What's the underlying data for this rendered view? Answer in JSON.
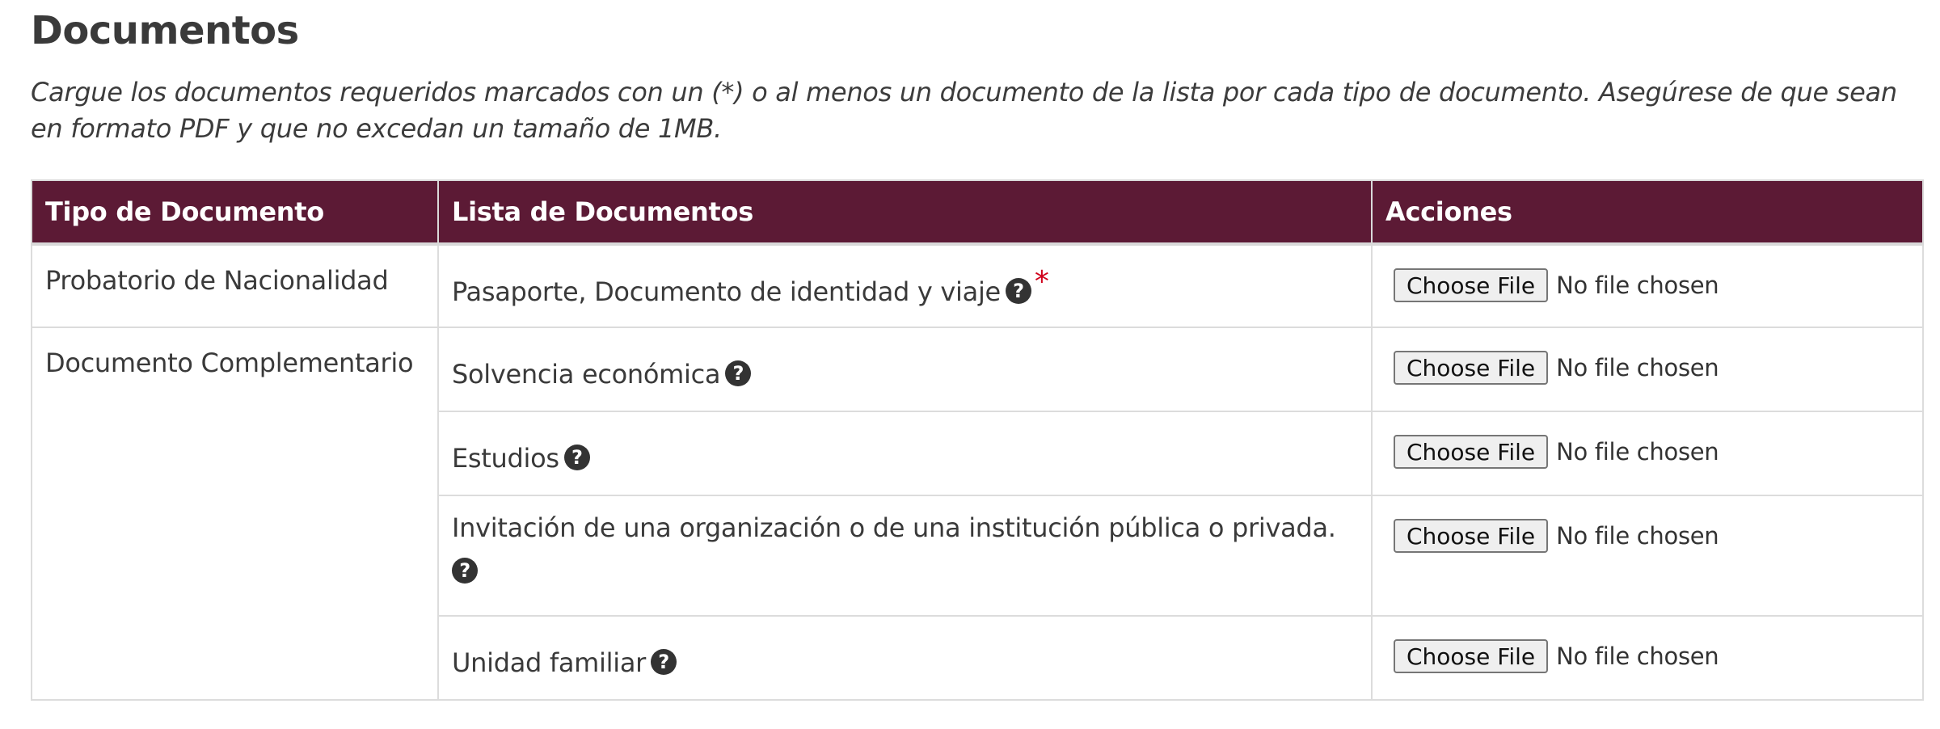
{
  "header": {
    "title": "Documentos",
    "description": "Cargue los documentos requeridos marcados con un (*) o al menos un documento de la lista por cada tipo de documento. Asegúrese de que sean en formato PDF y que no excedan un tamaño de 1MB."
  },
  "table": {
    "columns": [
      "Tipo de Documento",
      "Lista de Documentos",
      "Acciones"
    ],
    "types": [
      "Probatorio de Nacionalidad",
      "Documento Complementario"
    ],
    "rows": [
      {
        "document": "Pasaporte, Documento de identidad y viaje",
        "required_mark": "*",
        "button_label": "Choose File",
        "file_status": "No file chosen"
      },
      {
        "document": "Solvencia económica",
        "button_label": "Choose File",
        "file_status": "No file chosen"
      },
      {
        "document": "Estudios",
        "button_label": "Choose File",
        "file_status": "No file chosen"
      },
      {
        "document": "Invitación de una organización o de una institución pública o privada.",
        "button_label": "Choose File",
        "file_status": "No file chosen"
      },
      {
        "document": "Unidad familiar",
        "button_label": "Choose File",
        "file_status": "No file chosen"
      }
    ]
  },
  "icons": {
    "help": "question-circle-icon",
    "help_glyph": "?"
  },
  "colors": {
    "header_bg": "#5c1a35",
    "required": "#d0021b"
  }
}
